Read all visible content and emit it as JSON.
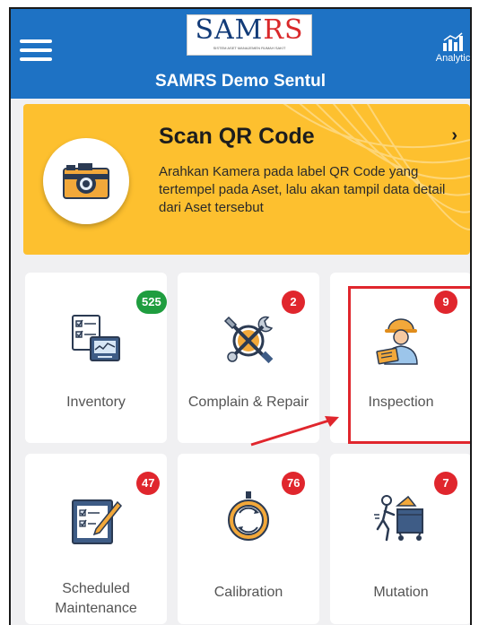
{
  "header": {
    "logo": {
      "part1": "SAM",
      "part2": "RS",
      "tagline": "SISTEM ASET MANAJEMEN RUMAH SAKIT"
    },
    "title": "SAMRS Demo Sentul",
    "analytic_label": "Analytic",
    "menu_icon": "hamburger-menu-icon",
    "analytic_icon": "bar-chart-icon"
  },
  "scan": {
    "title": "Scan QR Code",
    "description": "Arahkan Kamera pada label QR Code yang tertempel pada Aset, lalu akan tampil data detail dari Aset tersebut",
    "chevron": "›",
    "icon": "camera-icon"
  },
  "tiles": [
    {
      "label": "Inventory",
      "badge": "525",
      "badge_color": "#1f9d3f",
      "icon": "checklist-monitor-icon"
    },
    {
      "label": "Complain & Repair",
      "badge": "2",
      "badge_color": "#e0262d",
      "icon": "wrench-screwdriver-icon"
    },
    {
      "label": "Inspection",
      "badge": "9",
      "badge_color": "#e0262d",
      "icon": "inspector-icon"
    },
    {
      "label": "Scheduled Maintenance",
      "badge": "47",
      "badge_color": "#e0262d",
      "icon": "checklist-pencil-icon"
    },
    {
      "label": "Calibration",
      "badge": "76",
      "badge_color": "#e0262d",
      "icon": "calibration-ring-icon"
    },
    {
      "label": "Mutation",
      "badge": "7",
      "badge_color": "#e0262d",
      "icon": "moving-person-icon"
    }
  ],
  "colors": {
    "header_bg": "#1e72c4",
    "scan_bg": "#fdc02f",
    "highlight": "#e0262d"
  }
}
